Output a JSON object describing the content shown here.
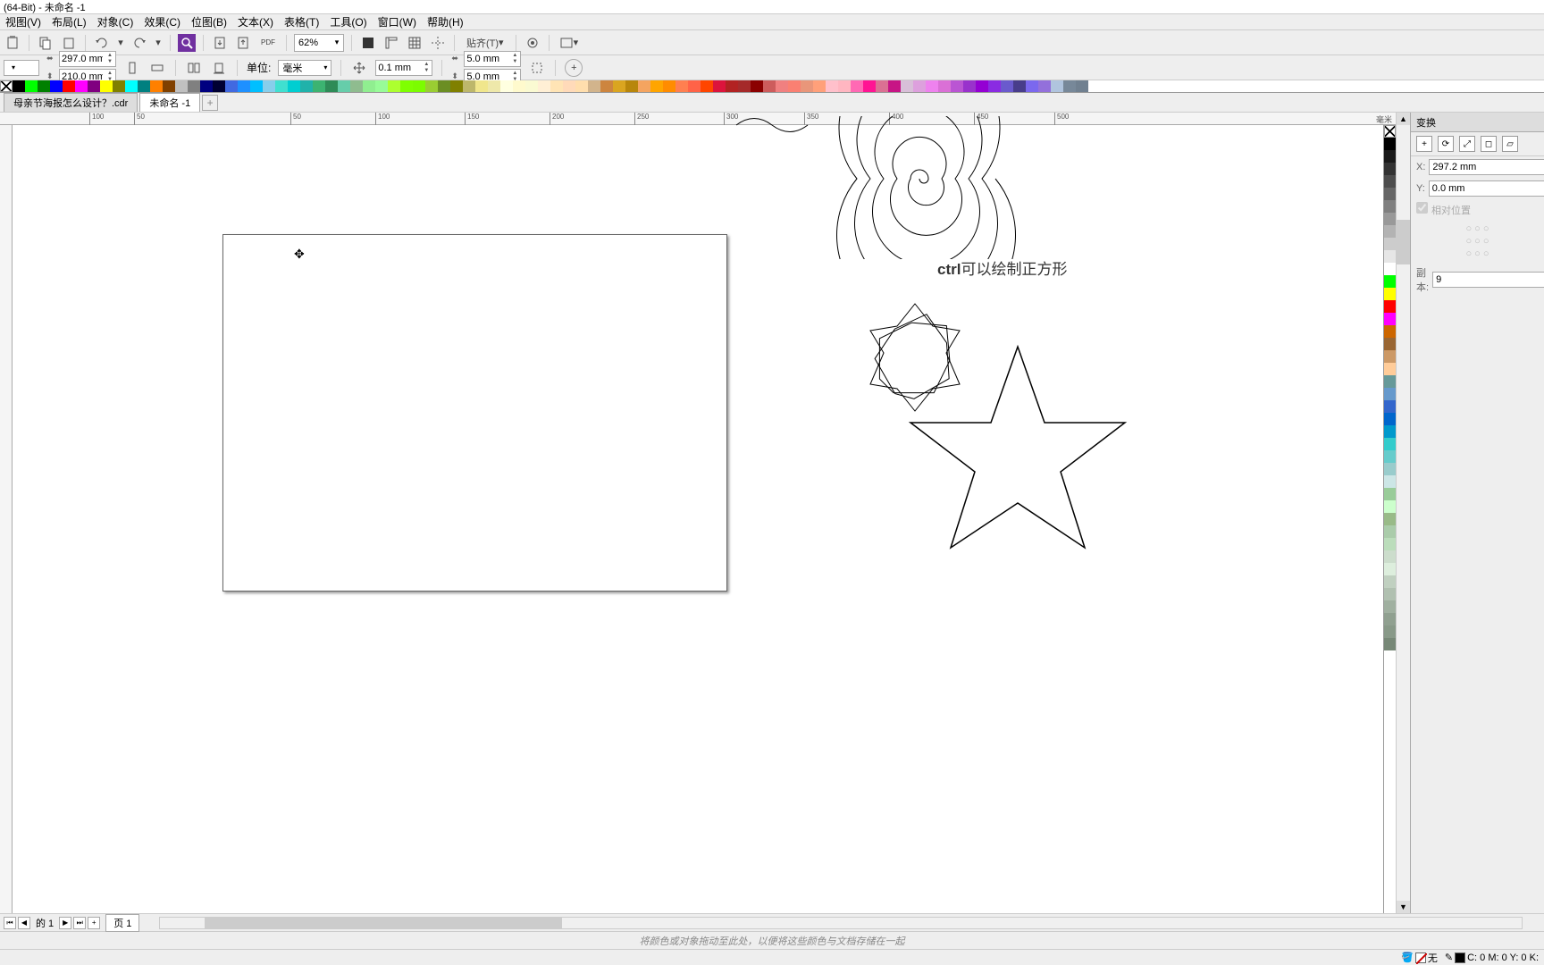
{
  "title": "(64-Bit) - 未命名 -1",
  "menu": [
    "视图(V)",
    "布局(L)",
    "对象(C)",
    "效果(C)",
    "位图(B)",
    "文本(X)",
    "表格(T)",
    "工具(O)",
    "窗口(W)",
    "帮助(H)"
  ],
  "toolbar1": {
    "zoom": "62%",
    "snap_label": "贴齐(T)"
  },
  "property_bar": {
    "width": "297.0 mm",
    "height": "210.0 mm",
    "units_label": "单位:",
    "units_value": "毫米",
    "nudge": "0.1 mm",
    "dup_x": "5.0 mm",
    "dup_y": "5.0 mm"
  },
  "tabs": [
    {
      "label": "母亲节海报怎么设计？.cdr",
      "active": false
    },
    {
      "label": "未命名 -1",
      "active": true
    }
  ],
  "ruler_ticks": [
    "100",
    "50",
    "50",
    "100",
    "150",
    "200",
    "250",
    "300",
    "350",
    "400",
    "450",
    "500"
  ],
  "ruler_unit": "毫米",
  "canvas_note": {
    "prefix": "ctrl",
    "rest": "可以绘制正方形"
  },
  "right_panel": {
    "tab": "变换",
    "x_label": "X:",
    "x_value": "297.2 mm",
    "y_label": "Y:",
    "y_value": "0.0 mm",
    "relative_label": "相对位置",
    "copies_label": "副本:",
    "copies_value": "9"
  },
  "pagebar": {
    "page_of": " 的 1",
    "page_tab": "页 1"
  },
  "hintbar_text": "将颜色或对象拖动至此处，以便将这些颜色与文档存储在一起",
  "statusbar": {
    "none_label": "无",
    "cmyk": "C: 0 M: 0 Y: 0 K:"
  },
  "palette_horizontal": [
    "#000000",
    "#00ff00",
    "#008000",
    "#0000ff",
    "#ff0000",
    "#ff00ff",
    "#800080",
    "#ffff00",
    "#808000",
    "#00ffff",
    "#008080",
    "#ff8000",
    "#804000",
    "#c0c0c0",
    "#808080",
    "#000080",
    "#000033",
    "#4169e1",
    "#1e90ff",
    "#00bfff",
    "#87ceeb",
    "#40e0d0",
    "#00ced1",
    "#20b2aa",
    "#3cb371",
    "#2e8b57",
    "#66cdaa",
    "#8fbc8f",
    "#90ee90",
    "#98fb98",
    "#adff2f",
    "#7fff00",
    "#7cfc00",
    "#9acd32",
    "#6b8e23",
    "#808000",
    "#bdb76b",
    "#f0e68c",
    "#eee8aa",
    "#ffffe0",
    "#fffacd",
    "#fafad2",
    "#ffefd5",
    "#ffe4b5",
    "#ffdab9",
    "#ffdead",
    "#d2b48c",
    "#cd853f",
    "#daa520",
    "#b8860b",
    "#f4a460",
    "#ffa500",
    "#ff8c00",
    "#ff7f50",
    "#ff6347",
    "#ff4500",
    "#dc143c",
    "#b22222",
    "#a52a2a",
    "#8b0000",
    "#cd5c5c",
    "#f08080",
    "#fa8072",
    "#e9967a",
    "#ffa07a",
    "#ffc0cb",
    "#ffb6c1",
    "#ff69b4",
    "#ff1493",
    "#db7093",
    "#c71585",
    "#d8bfd8",
    "#dda0dd",
    "#ee82ee",
    "#da70d6",
    "#ba55d3",
    "#9932cc",
    "#9400d3",
    "#8a2be2",
    "#6a5acd",
    "#483d8b",
    "#7b68ee",
    "#9370db",
    "#b0c4de",
    "#778899",
    "#708090"
  ],
  "palette_vertical": [
    "#000000",
    "#1a1a1a",
    "#333333",
    "#4d4d4d",
    "#666666",
    "#808080",
    "#999999",
    "#b3b3b3",
    "#cccccc",
    "#e6e6e6",
    "#ffffff",
    "#00ff00",
    "#ffff00",
    "#ff0000",
    "#ff00ff",
    "#cc6600",
    "#996633",
    "#cc9966",
    "#ffcc99",
    "#669999",
    "#6699cc",
    "#3366cc",
    "#0066cc",
    "#0099cc",
    "#33cccc",
    "#66cccc",
    "#99cccc",
    "#cce6e6",
    "#99cc99",
    "#ccffcc",
    "#99bb88",
    "#aaccaa",
    "#bbddbb",
    "#ccddcc",
    "#ddeedd",
    "#c0d0c0",
    "#b0c0b0",
    "#a0b0a0",
    "#90a090",
    "#889988",
    "#778877"
  ]
}
